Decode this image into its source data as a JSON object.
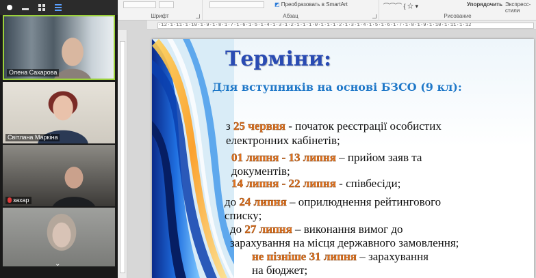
{
  "zoom": {
    "participants": [
      {
        "name": "Олена Сахарова"
      },
      {
        "name": "Світлана Маркіна"
      },
      {
        "name": "захар"
      },
      {
        "name": ""
      }
    ],
    "more_icon": "chevron-down-icon"
  },
  "ribbon": {
    "groups": {
      "font": "Шрифт",
      "paragraph": "Абзац",
      "drawing": "Рисование"
    },
    "smartart_label": "Преобразовать в SmartArt",
    "arrange_label": "Упорядочить",
    "quick_styles_label": "Экспресс-стили"
  },
  "ruler": {
    "ticks": "·12·1·11·1·10·1·9·1·8·1·7·1·6·1·5·1·4·1·3·1·2·1·1·1·0·1·1·1·2·1·3·1·4·1·5·1·6·1·7·1·8·1·9·1·10·1·11·1·12"
  },
  "slide": {
    "title": "Терміни:",
    "subtitle": "Для вступників на основі БЗСО (9 кл):",
    "items": [
      {
        "lines": [
          {
            "pre": "з ",
            "hl": "25 червня",
            "post": "  - початок реєстрації  особистих"
          },
          {
            "pre": "електронних кабінетів;",
            "hl": "",
            "post": ""
          }
        ]
      },
      {
        "lines": [
          {
            "pre": "",
            "hl": "01 липня - 13 липня",
            "post": " – прийом заяв та"
          },
          {
            "pre": "документів;",
            "hl": "",
            "post": ""
          }
        ]
      },
      {
        "lines": [
          {
            "pre": "",
            "hl": "14 липня - 22 липня",
            "post": " -   співбесіди;"
          }
        ]
      },
      {
        "lines": [
          {
            "pre": "до ",
            "hl": "24 липня",
            "post": " – оприлюднення рейтингового"
          },
          {
            "pre": "списку;",
            "hl": "",
            "post": ""
          }
        ]
      },
      {
        "lines": [
          {
            "pre": "до ",
            "hl": "27 липня",
            "post": " – виконання вимог до"
          },
          {
            "pre": "зарахування на місця державного замовлення;",
            "hl": "",
            "post": ""
          }
        ]
      },
      {
        "lines": [
          {
            "pre": "",
            "hl": "не пізніше 31 липня",
            "post": " – зарахування"
          },
          {
            "pre": "на бюджет;",
            "hl": "",
            "post": ""
          }
        ]
      }
    ]
  }
}
